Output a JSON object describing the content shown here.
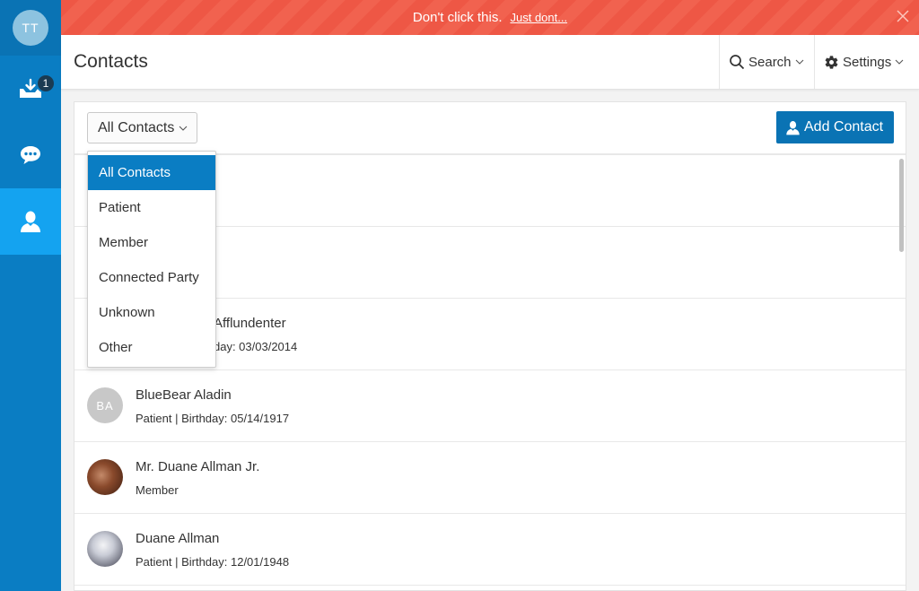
{
  "sidebar": {
    "user_initials": "TT",
    "inbox_badge": "1",
    "items": [
      {
        "icon": "inbox-download-icon"
      },
      {
        "icon": "chat-bubble-icon"
      },
      {
        "icon": "contact-person-icon"
      }
    ]
  },
  "banner": {
    "text": "Don't click this.",
    "link": "Just dont...",
    "colors": {
      "bg": "#ee5745",
      "stripe": "#f1624f"
    }
  },
  "header": {
    "title": "Contacts",
    "search_label": "Search",
    "settings_label": "Settings"
  },
  "toolbar": {
    "filter_label": "All Contacts",
    "add_label": "Add Contact"
  },
  "dropdown": {
    "selected": "All Contacts",
    "options": [
      "All Contacts",
      "Patient",
      "Member",
      "Connected Party",
      "Unknown",
      "Other"
    ]
  },
  "contacts": [
    {
      "name": "",
      "meta": "",
      "initials": ""
    },
    {
      "name": "",
      "meta": "",
      "initials": ""
    },
    {
      "name": "Afflundenter",
      "meta": "day: 03/03/2014",
      "initials": ""
    },
    {
      "name": "BlueBear Aladin",
      "meta": "Patient | Birthday: 05/14/1917",
      "initials": "BA"
    },
    {
      "name": "Mr. Duane Allman Jr.",
      "meta": "Member",
      "initials": ""
    },
    {
      "name": "Duane Allman",
      "meta": "Patient | Birthday: 12/01/1948",
      "initials": ""
    }
  ],
  "colors": {
    "sidebar": "#0a7dc3",
    "sidebar_active": "#14a3f0",
    "primary_button": "#0a73b4"
  }
}
